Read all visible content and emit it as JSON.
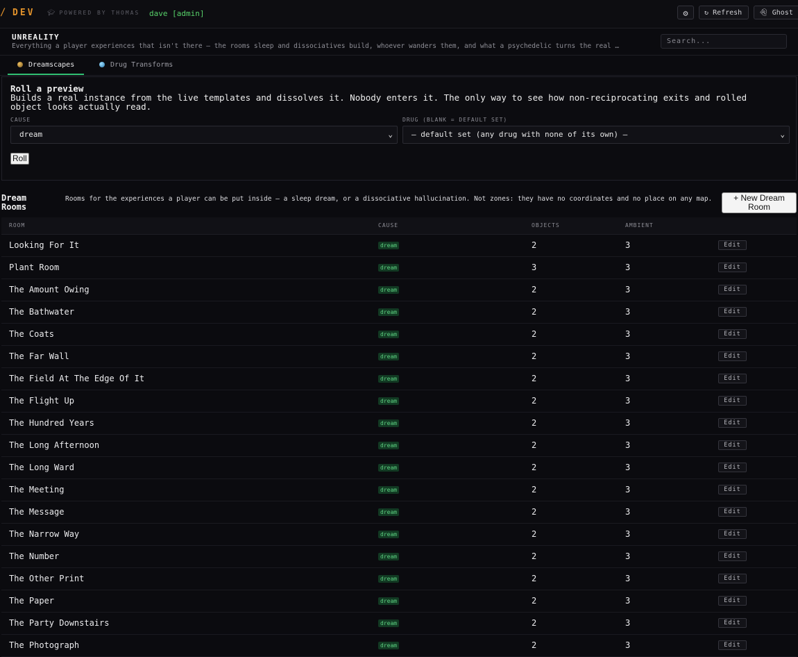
{
  "topbar": {
    "brand_mark": "/",
    "brand": "DEV",
    "powered": "POWERED BY THOMAS",
    "user": "dave [admin]",
    "refresh_label": "Refresh",
    "ghost_label": "Ghost"
  },
  "header": {
    "title": "UNREALITY",
    "subtitle": "Everything a player experiences that isn't there — the rooms sleep and dissociatives build, whoever wanders them, and what a psychedelic turns the real …",
    "search_placeholder": "Search..."
  },
  "tabs": [
    {
      "label": "Dreamscapes",
      "active": true
    },
    {
      "label": "Drug Transforms",
      "active": false
    }
  ],
  "roll": {
    "title": "Roll a preview",
    "description": "Builds a real instance from the live templates and dissolves it. Nobody enters it. The only way to see how non-reciprocating exits and rolled object looks actually read.",
    "cause_label": "CAUSE",
    "cause_value": "dream",
    "drug_label": "DRUG (BLANK = DEFAULT SET)",
    "drug_value": "— default set (any drug with none of its own) —",
    "button": "Roll"
  },
  "rooms": {
    "title": "Dream Rooms",
    "description": "Rooms for the experiences a player can be put inside — a sleep dream, or a dissociative hallucination. Not zones: they have no coordinates and no place on any map.",
    "new_button": "+ New Dream Room",
    "columns": {
      "room": "ROOM",
      "cause": "CAUSE",
      "objects": "OBJECTS",
      "ambient": "AMBIENT"
    },
    "edit_label": "Edit",
    "rows": [
      {
        "name": "Looking For It",
        "cause": "dream",
        "objects": "2",
        "ambient": "3"
      },
      {
        "name": "Plant Room",
        "cause": "dream",
        "objects": "3",
        "ambient": "3"
      },
      {
        "name": "The Amount Owing",
        "cause": "dream",
        "objects": "2",
        "ambient": "3"
      },
      {
        "name": "The Bathwater",
        "cause": "dream",
        "objects": "2",
        "ambient": "3"
      },
      {
        "name": "The Coats",
        "cause": "dream",
        "objects": "2",
        "ambient": "3"
      },
      {
        "name": "The Far Wall",
        "cause": "dream",
        "objects": "2",
        "ambient": "3"
      },
      {
        "name": "The Field At The Edge Of It",
        "cause": "dream",
        "objects": "2",
        "ambient": "3"
      },
      {
        "name": "The Flight Up",
        "cause": "dream",
        "objects": "2",
        "ambient": "3"
      },
      {
        "name": "The Hundred Years",
        "cause": "dream",
        "objects": "2",
        "ambient": "3"
      },
      {
        "name": "The Long Afternoon",
        "cause": "dream",
        "objects": "2",
        "ambient": "3"
      },
      {
        "name": "The Long Ward",
        "cause": "dream",
        "objects": "2",
        "ambient": "3"
      },
      {
        "name": "The Meeting",
        "cause": "dream",
        "objects": "2",
        "ambient": "3"
      },
      {
        "name": "The Message",
        "cause": "dream",
        "objects": "2",
        "ambient": "3"
      },
      {
        "name": "The Narrow Way",
        "cause": "dream",
        "objects": "2",
        "ambient": "3"
      },
      {
        "name": "The Number",
        "cause": "dream",
        "objects": "2",
        "ambient": "3"
      },
      {
        "name": "The Other Print",
        "cause": "dream",
        "objects": "2",
        "ambient": "3"
      },
      {
        "name": "The Paper",
        "cause": "dream",
        "objects": "2",
        "ambient": "3"
      },
      {
        "name": "The Party Downstairs",
        "cause": "dream",
        "objects": "2",
        "ambient": "3"
      },
      {
        "name": "The Photograph",
        "cause": "dream",
        "objects": "2",
        "ambient": "3"
      }
    ]
  }
}
